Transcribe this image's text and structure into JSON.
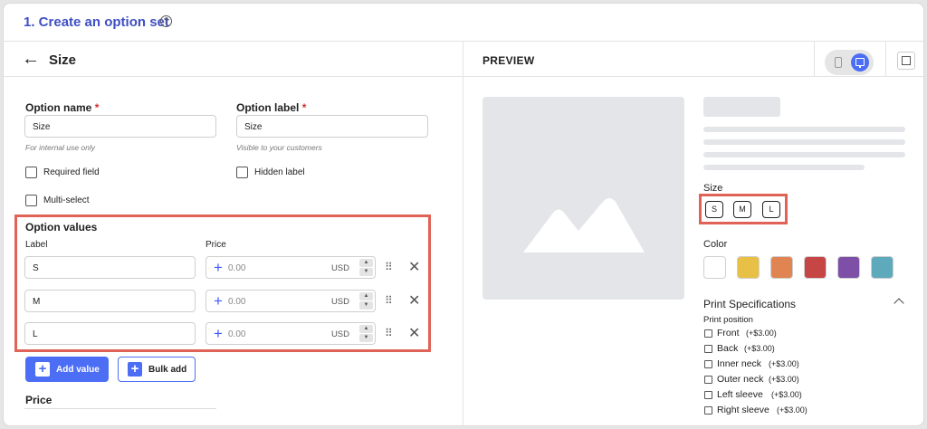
{
  "header": {
    "title": "1. Create an option set",
    "help_icon": "?"
  },
  "editor": {
    "back_icon": "←",
    "title": "Size",
    "option_name": {
      "label": "Option name",
      "required_mark": "*",
      "value": "Size",
      "hint": "For internal use only"
    },
    "option_label": {
      "label": "Option label",
      "required_mark": "*",
      "value": "Size",
      "hint": "Visible to your customers"
    },
    "checkboxes": {
      "required_field": "Required field",
      "hidden_label": "Hidden label",
      "multi_select": "Multi-select"
    },
    "option_values": {
      "title": "Option values",
      "label_col": "Label",
      "price_col": "Price",
      "rows": [
        {
          "label": "S",
          "price_placeholder": "0.00",
          "currency": "USD"
        },
        {
          "label": "M",
          "price_placeholder": "0.00",
          "currency": "USD"
        },
        {
          "label": "L",
          "price_placeholder": "0.00",
          "currency": "USD"
        }
      ],
      "plus_icon": "+",
      "step_up": "▲",
      "step_down": "▼",
      "drag_icon": "⠿",
      "delete_icon": "✕"
    },
    "add_value_label": "Add value",
    "bulk_add_label": "Bulk add",
    "button_plus_icon": "+",
    "price_section_title": "Price"
  },
  "preview": {
    "title": "PREVIEW",
    "size_label": "Size",
    "sizes": [
      "S",
      "M",
      "L"
    ],
    "color_label": "Color",
    "colors": [
      "#ffffff",
      "#e9c046",
      "#e08552",
      "#c64545",
      "#7d4fa6",
      "#5fa9bd"
    ],
    "print_spec_title": "Print Specifications",
    "print_position_label": "Print position",
    "positions": [
      {
        "name": "Front",
        "price": "(+$3.00)"
      },
      {
        "name": "Back",
        "price": "(+$3.00)"
      },
      {
        "name": "Inner neck",
        "price": "(+$3.00)"
      },
      {
        "name": "Outer neck",
        "price": "(+$3.00)"
      },
      {
        "name": "Left sleeve",
        "price": "(+$3.00)"
      },
      {
        "name": "Right sleeve",
        "price": "(+$3.00)"
      }
    ]
  },
  "colors": {
    "accent": "#4c6ef5",
    "title_blue": "#3f4fc4",
    "highlight": "#e06357",
    "required": "#d32f2f"
  }
}
